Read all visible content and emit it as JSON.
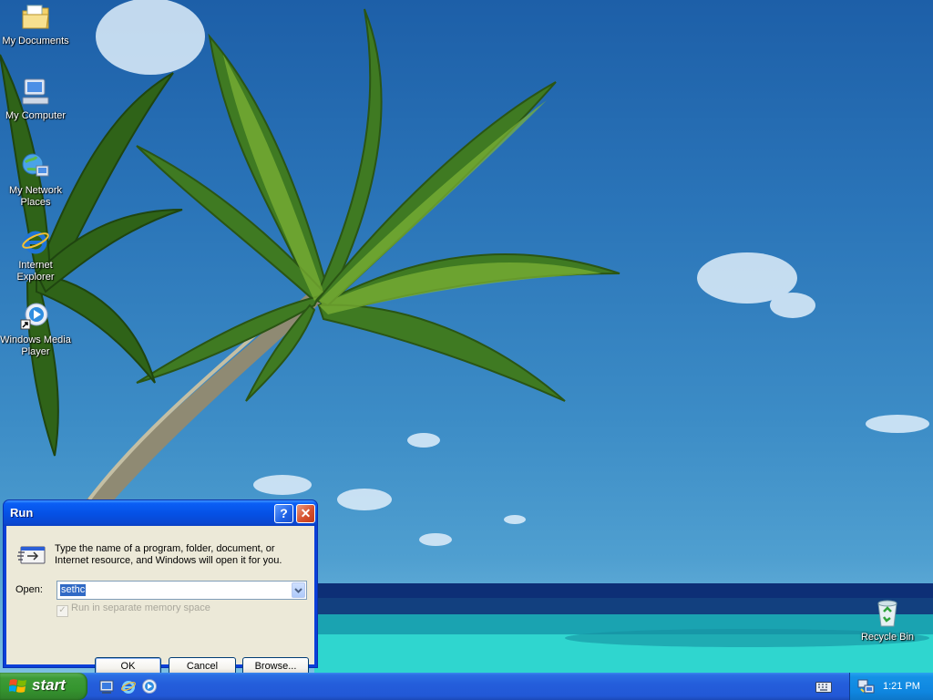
{
  "desktop": {
    "icons": [
      {
        "label": "My Documents",
        "icon": "folder-documents-icon"
      },
      {
        "label": "My Computer",
        "icon": "computer-icon"
      },
      {
        "label": "My Network Places",
        "icon": "network-places-icon"
      },
      {
        "label": "Internet Explorer",
        "icon": "internet-explorer-icon"
      },
      {
        "label": "Windows Media Player",
        "icon": "media-player-icon"
      },
      {
        "label": "Recycle Bin",
        "icon": "recycle-bin-icon"
      }
    ]
  },
  "run_dialog": {
    "title": "Run",
    "description": "Type the name of a program, folder, document, or Internet resource, and Windows will open it for you.",
    "open_label": "Open:",
    "open_value": "sethc",
    "separate_memory_label": "Run in separate memory space",
    "separate_memory_checked": true,
    "separate_memory_enabled": false,
    "ok_label": "OK",
    "cancel_label": "Cancel",
    "browse_label": "Browse...",
    "help_glyph": "?",
    "close_glyph": "✕"
  },
  "taskbar": {
    "start_label": "start",
    "quick_launch": [
      "show-desktop-icon",
      "internet-explorer-icon",
      "media-player-icon"
    ],
    "tray": {
      "time": "1:21 PM",
      "icons": [
        "keyboard-icon",
        "network-icon"
      ]
    }
  },
  "colors": {
    "taskbar": "#245edb",
    "start_button": "#3d9b37",
    "dialog_title": "#0a5ef5",
    "dialog_face": "#ece9d8",
    "selection": "#316ac5"
  }
}
